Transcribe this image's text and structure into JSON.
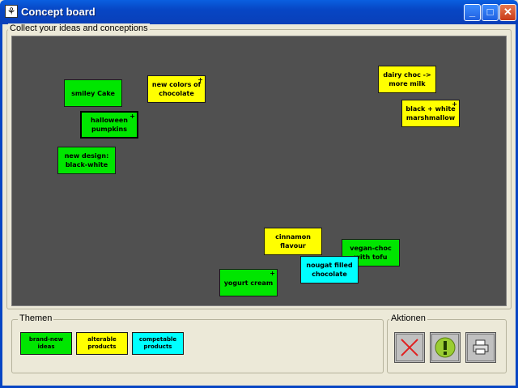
{
  "window": {
    "title": "Concept board",
    "icon": "app-icon",
    "minimize": "_",
    "maximize": "□",
    "close": "✕"
  },
  "board": {
    "label": "Collect your ideas and conceptions",
    "notes": [
      {
        "text": "smiley Cake",
        "color": "#00e600",
        "marked": false
      },
      {
        "text": "new colors of chocolate",
        "color": "#ffff00",
        "marked": true
      },
      {
        "text": "halloween pumpkins",
        "color": "#00e600",
        "marked": true
      },
      {
        "text": "new design: black-white",
        "color": "#00e600",
        "marked": false
      },
      {
        "text": "dairy choc -> more milk",
        "color": "#ffff00",
        "marked": false
      },
      {
        "text": "black + white marshmallow",
        "color": "#ffff00",
        "marked": true
      },
      {
        "text": "cinnamon flavour",
        "color": "#ffff00",
        "marked": false
      },
      {
        "text": "vegan-choc with tofu",
        "color": "#00e600",
        "marked": false
      },
      {
        "text": "nougat filled chocolate",
        "color": "#00ffff",
        "marked": false
      },
      {
        "text": "yogurt cream",
        "color": "#00e600",
        "marked": true
      }
    ],
    "plus_sign": "+"
  },
  "themes": {
    "label": "Themen",
    "items": [
      {
        "text": "brand-new ideas",
        "color": "#00e600"
      },
      {
        "text": "alterable products",
        "color": "#ffff00"
      },
      {
        "text": "competable products",
        "color": "#00ffff"
      }
    ]
  },
  "actions": {
    "label": "Aktionen",
    "items": [
      {
        "icon": "delete-x-icon"
      },
      {
        "icon": "exclamation-icon"
      },
      {
        "icon": "printer-icon"
      }
    ]
  }
}
